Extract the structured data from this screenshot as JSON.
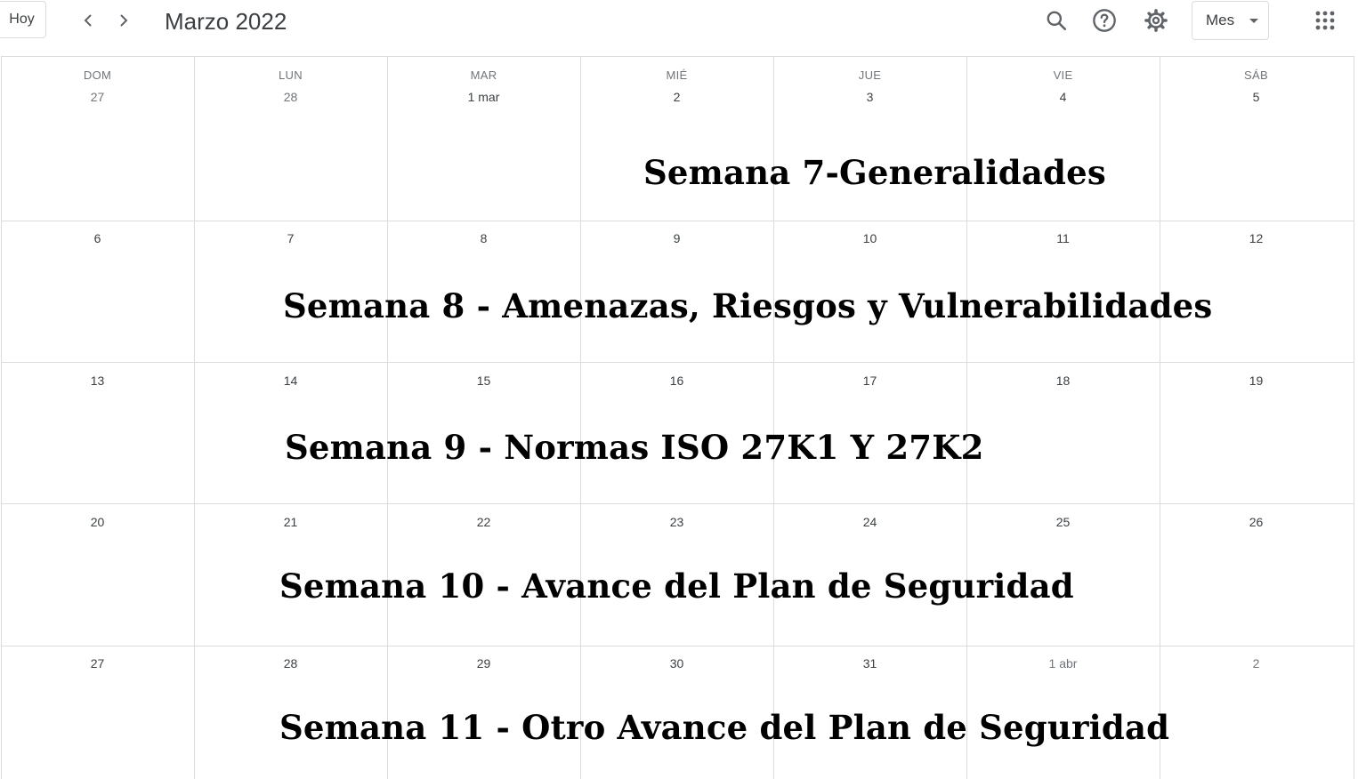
{
  "header": {
    "today_label": "Hoy",
    "prev_icon": "chevron-left-icon",
    "next_icon": "chevron-right-icon",
    "month_title": "Marzo 2022",
    "search_icon": "search-icon",
    "help_icon": "help-icon",
    "settings_icon": "gear-icon",
    "view_label": "Mes",
    "apps_icon": "apps-grid-icon"
  },
  "weekdays": [
    "DOM",
    "LUN",
    "MAR",
    "MIÉ",
    "JUE",
    "VIE",
    "SÁB"
  ],
  "weeks": [
    [
      "27",
      "28",
      "1 mar",
      "2",
      "3",
      "4",
      "5"
    ],
    [
      "6",
      "7",
      "8",
      "9",
      "10",
      "11",
      "12"
    ],
    [
      "13",
      "14",
      "15",
      "16",
      "17",
      "18",
      "19"
    ],
    [
      "20",
      "21",
      "22",
      "23",
      "24",
      "25",
      "26"
    ],
    [
      "27",
      "28",
      "29",
      "30",
      "31",
      "1 abr",
      "2"
    ]
  ],
  "events": [
    "Semana 7-Generalidades",
    "Semana 8 - Amenazas, Riesgos y Vulnerabilidades",
    "Semana 9 - Normas ISO 27K1 Y 27K2",
    "Semana 10 - Avance del Plan de Seguridad",
    "Semana 11 - Otro Avance del Plan de Seguridad"
  ]
}
